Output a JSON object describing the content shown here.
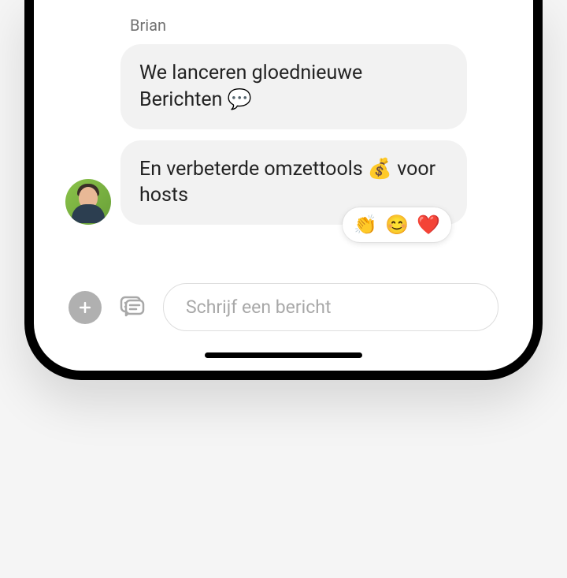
{
  "sender": {
    "name": "Brian"
  },
  "messages": [
    {
      "text": "We lanceren gloednieuwe Berichten 💬"
    },
    {
      "text": "En verbeterde omzettools 💰 voor hosts"
    }
  ],
  "reactions": [
    "👏",
    "😊",
    "❤️"
  ],
  "composer": {
    "placeholder": "Schrijf een bericht"
  }
}
